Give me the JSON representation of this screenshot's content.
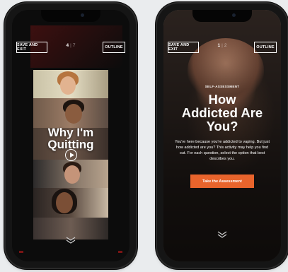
{
  "left_phone": {
    "save_label": "SAVE AND EXIT",
    "page_current": "4",
    "page_separator": "|",
    "page_total": "7",
    "outline_label": "OUTLINE",
    "collage_title_line1": "Why I'm",
    "collage_title_line2": "Quitting",
    "play_icon": "play-circle-icon",
    "scroll_icon": "double-chevron-down-icon"
  },
  "right_phone": {
    "save_label": "SAVE AND EXIT",
    "page_current": "1",
    "page_separator": "|",
    "page_total": "2",
    "outline_label": "OUTLINE",
    "eyebrow": "SELF-ASSESSMENT",
    "headline_line1": "How",
    "headline_line2": "Addicted Are",
    "headline_line3": "You?",
    "body": "You're here because you're addicted to vaping. But just how addicted are you? This activity may help you find out. For each question, select the option that best describes you.",
    "cta_label": "Take the Assessment",
    "scroll_icon": "double-chevron-down-icon"
  },
  "colors": {
    "accent_orange": "#e8642c",
    "phone_body": "#151515",
    "background": "#eaecee"
  }
}
